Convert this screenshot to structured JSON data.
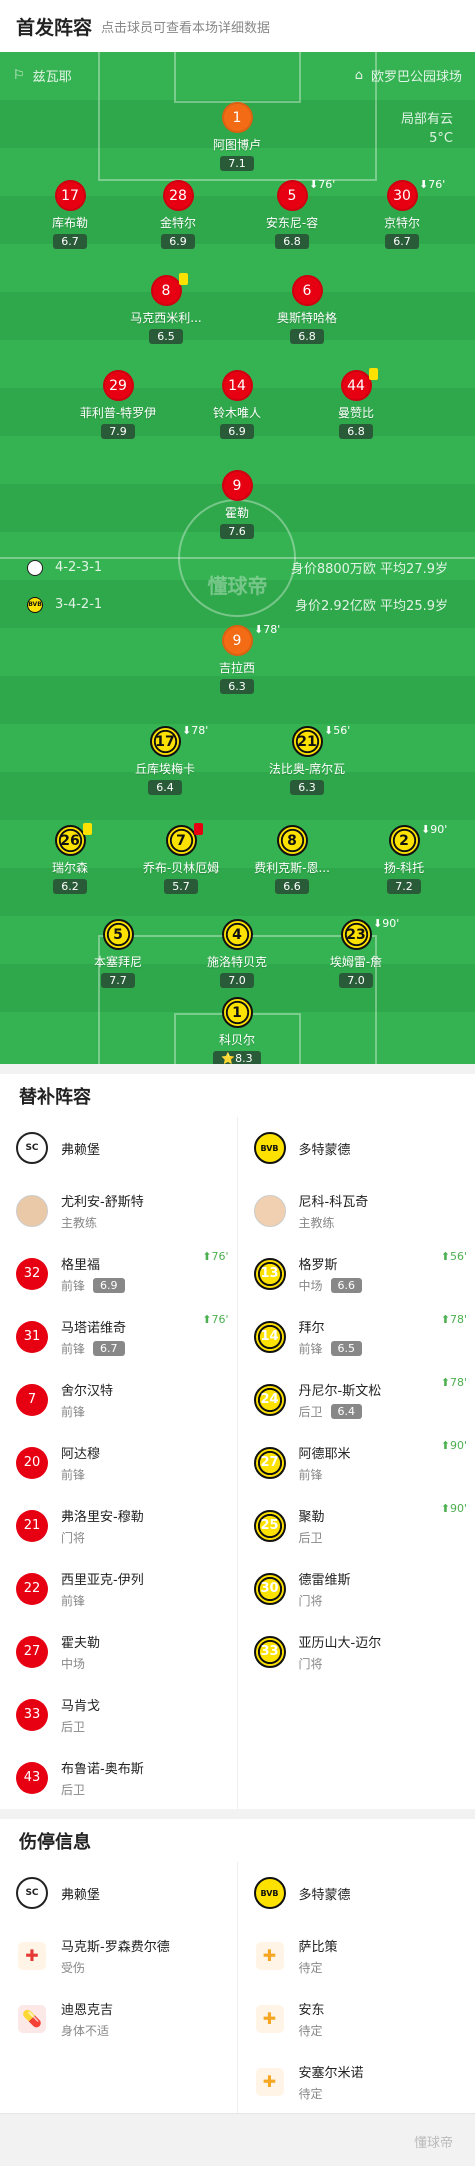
{
  "header": {
    "title": "首发阵容",
    "subtitle": "点击球员可查看本场详细数据"
  },
  "pitch": {
    "home_team": "兹瓦耶",
    "venue": "欧罗巴公园球场",
    "weather": "局部有云",
    "temp": "5°C",
    "home_form": "4-2-3-1",
    "home_value": "身价8800万欧 平均27.9岁",
    "away_form": "3-4-2-1",
    "away_value": "身价2.92亿欧 平均25.9岁",
    "watermark": "懂球帝"
  },
  "home": [
    {
      "num": "1",
      "name": "阿图博卢",
      "rating": "7.1"
    },
    {
      "num": "17",
      "name": "库布勒",
      "rating": "6.7"
    },
    {
      "num": "28",
      "name": "金特尔",
      "rating": "6.9"
    },
    {
      "num": "5",
      "name": "安东尼-容",
      "rating": "6.8",
      "min": "76'"
    },
    {
      "num": "30",
      "name": "京特尔",
      "rating": "6.7",
      "min": "76'"
    },
    {
      "num": "8",
      "name": "马克西米利...",
      "rating": "6.5"
    },
    {
      "num": "6",
      "name": "奥斯特哈格",
      "rating": "6.8"
    },
    {
      "num": "29",
      "name": "菲利普-特罗伊",
      "rating": "7.9"
    },
    {
      "num": "14",
      "name": "铃木唯人",
      "rating": "6.9"
    },
    {
      "num": "44",
      "name": "曼赞比",
      "rating": "6.8"
    },
    {
      "num": "9",
      "name": "霍勒",
      "rating": "7.6"
    }
  ],
  "away": [
    {
      "num": "9",
      "name": "吉拉西",
      "rating": "6.3",
      "min": "78'"
    },
    {
      "num": "17",
      "name": "丘库埃梅卡",
      "rating": "6.4",
      "min": "78'"
    },
    {
      "num": "21",
      "name": "法比奥-席尔瓦",
      "rating": "6.3",
      "min": "56'"
    },
    {
      "num": "26",
      "name": "瑞尔森",
      "rating": "6.2"
    },
    {
      "num": "7",
      "name": "乔布-贝林厄姆",
      "rating": "5.7"
    },
    {
      "num": "8",
      "name": "费利克斯-恩...",
      "rating": "6.6"
    },
    {
      "num": "2",
      "name": "扬-科托",
      "rating": "7.2",
      "min": "90'"
    },
    {
      "num": "5",
      "name": "本塞拜尼",
      "rating": "7.7"
    },
    {
      "num": "4",
      "name": "施洛特贝克",
      "rating": "7.0"
    },
    {
      "num": "23",
      "name": "埃姆雷-詹",
      "rating": "7.0",
      "min": "90'"
    },
    {
      "num": "1",
      "name": "科贝尔",
      "rating": "8.3"
    }
  ],
  "subs_title": "替补阵容",
  "subs_home": {
    "team": "弗赖堡",
    "coach": {
      "name": "尤利安-舒斯特",
      "role": "主教练"
    },
    "players": [
      {
        "num": "32",
        "name": "格里福",
        "pos": "前锋",
        "rating": "6.9",
        "min": "76'"
      },
      {
        "num": "31",
        "name": "马塔诺维奇",
        "pos": "前锋",
        "rating": "6.7",
        "min": "76'"
      },
      {
        "num": "7",
        "name": "舍尔汉特",
        "pos": "前锋"
      },
      {
        "num": "20",
        "name": "阿达穆",
        "pos": "前锋"
      },
      {
        "num": "21",
        "name": "弗洛里安-穆勒",
        "pos": "门将"
      },
      {
        "num": "22",
        "name": "西里亚克-伊列",
        "pos": "前锋"
      },
      {
        "num": "27",
        "name": "霍夫勒",
        "pos": "中场"
      },
      {
        "num": "33",
        "name": "马肯戈",
        "pos": "后卫"
      },
      {
        "num": "43",
        "name": "布鲁诺-奥布斯",
        "pos": "后卫"
      }
    ]
  },
  "subs_away": {
    "team": "多特蒙德",
    "coach": {
      "name": "尼科-科瓦奇",
      "role": "主教练"
    },
    "players": [
      {
        "num": "13",
        "name": "格罗斯",
        "pos": "中场",
        "rating": "6.6",
        "min": "56'"
      },
      {
        "num": "14",
        "name": "拜尔",
        "pos": "前锋",
        "rating": "6.5",
        "min": "78'"
      },
      {
        "num": "24",
        "name": "丹尼尔-斯文松",
        "pos": "后卫",
        "rating": "6.4",
        "min": "78'"
      },
      {
        "num": "27",
        "name": "阿德耶米",
        "pos": "前锋",
        "min": "90'"
      },
      {
        "num": "25",
        "name": "聚勒",
        "pos": "后卫",
        "min": "90'"
      },
      {
        "num": "30",
        "name": "德雷维斯",
        "pos": "门将"
      },
      {
        "num": "33",
        "name": "亚历山大-迈尔",
        "pos": "门将"
      }
    ]
  },
  "inj_title": "伤停信息",
  "inj_home": {
    "team": "弗赖堡",
    "players": [
      {
        "name": "马克斯-罗森费尔德",
        "status": "受伤"
      },
      {
        "name": "迪恩克吉",
        "status": "身体不适"
      }
    ]
  },
  "inj_away": {
    "team": "多特蒙德",
    "players": [
      {
        "name": "萨比策",
        "status": "待定"
      },
      {
        "name": "安东",
        "status": "待定"
      },
      {
        "name": "安塞尔米诺",
        "status": "待定"
      }
    ]
  },
  "footer": "懂球帝"
}
